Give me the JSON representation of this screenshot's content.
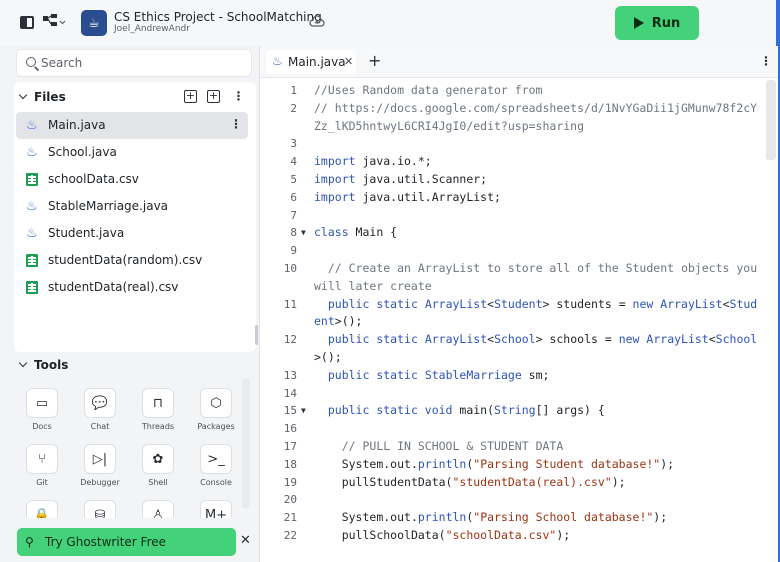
{
  "header": {
    "project_title": "CS Ethics Project - SchoolMatching",
    "user": "Joel_AndrewAndr",
    "run_label": "Run"
  },
  "sidebar": {
    "search_placeholder": "Search",
    "files_title": "Files",
    "files": [
      {
        "name": "Main.java",
        "type": "java",
        "active": true
      },
      {
        "name": "School.java",
        "type": "java"
      },
      {
        "name": "schoolData.csv",
        "type": "csv"
      },
      {
        "name": "StableMarriage.java",
        "type": "java"
      },
      {
        "name": "Student.java",
        "type": "java"
      },
      {
        "name": "studentData(random).csv",
        "type": "csv"
      },
      {
        "name": "studentData(real).csv",
        "type": "csv"
      }
    ],
    "tools_title": "Tools",
    "tools": [
      {
        "label": "Docs",
        "icon": "book-icon"
      },
      {
        "label": "Chat",
        "icon": "chat-icon"
      },
      {
        "label": "Threads",
        "icon": "inbox-icon"
      },
      {
        "label": "Packages",
        "icon": "package-icon"
      },
      {
        "label": "Git",
        "icon": "git-icon"
      },
      {
        "label": "Debugger",
        "icon": "debugger-icon"
      },
      {
        "label": "Shell",
        "icon": "shell-icon"
      },
      {
        "label": "Console",
        "icon": "console-icon"
      },
      {
        "label": "",
        "icon": "lock-icon"
      },
      {
        "label": "",
        "icon": "database-icon"
      },
      {
        "label": "",
        "icon": "user-icon"
      },
      {
        "label": "",
        "icon": "markdown-icon"
      }
    ],
    "ghostwriter_label": "Try Ghostwriter Free"
  },
  "editor": {
    "tab_label": "Main.java",
    "lines": [
      {
        "n": "1",
        "html": "<span class=\"c\">//Uses Random data generator from</span>"
      },
      {
        "n": "2",
        "html": "<span class=\"c\">// https://docs.google.com/spreadsheets/d/1NvYGaDii1jGMunw78f2cYZz_lKD5hntwyL6CRI4JgI0/edit?usp=sharing</span>"
      },
      {
        "n": "3",
        "html": ""
      },
      {
        "n": "4",
        "html": "<span class=\"k\">import</span> java.io.*;"
      },
      {
        "n": "5",
        "html": "<span class=\"k\">import</span> java.util.Scanner;"
      },
      {
        "n": "6",
        "html": "<span class=\"k\">import</span> java.util.ArrayList;"
      },
      {
        "n": "7",
        "html": ""
      },
      {
        "n": "8",
        "fold": true,
        "html": "<span class=\"k\">class</span> Main {"
      },
      {
        "n": "9",
        "html": ""
      },
      {
        "n": "10",
        "html": "  <span class=\"c\">// Create an ArrayList to store all of the Student objects you will later create</span>"
      },
      {
        "n": "11",
        "html": "  <span class=\"k\">public static</span> <span class=\"k\">ArrayList</span>&lt;<span class=\"k\">Student</span>&gt; students = <span class=\"k\">new</span> <span class=\"k\">ArrayList</span>&lt;<span class=\"k\">Student</span>&gt;();"
      },
      {
        "n": "12",
        "html": "  <span class=\"k\">public static</span> <span class=\"k\">ArrayList</span>&lt;<span class=\"k\">School</span>&gt; schools = <span class=\"k\">new</span> <span class=\"k\">ArrayList</span>&lt;<span class=\"k\">School</span>&gt;();"
      },
      {
        "n": "13",
        "html": "  <span class=\"k\">public static</span> <span class=\"k\">StableMarriage</span> sm;"
      },
      {
        "n": "14",
        "html": ""
      },
      {
        "n": "15",
        "fold": true,
        "html": "  <span class=\"k\">public static void</span> main(<span class=\"k\">String</span>[] args) {"
      },
      {
        "n": "16",
        "html": ""
      },
      {
        "n": "17",
        "html": "    <span class=\"c\">// PULL IN SCHOOL &amp; STUDENT DATA</span>"
      },
      {
        "n": "18",
        "html": "    System.out.<span class=\"k\">println</span>(<span class=\"s\">\"Parsing Student database!\"</span>);"
      },
      {
        "n": "19",
        "html": "    pullStudentData(<span class=\"s\">\"studentData(real).csv\"</span>);"
      },
      {
        "n": "20",
        "html": ""
      },
      {
        "n": "21",
        "html": "    System.out.<span class=\"k\">println</span>(<span class=\"s\">\"Parsing School database!\"</span>);"
      },
      {
        "n": "22",
        "html": "    pullSchoolData(<span class=\"s\">\"schoolData.csv\"</span>);"
      }
    ]
  }
}
